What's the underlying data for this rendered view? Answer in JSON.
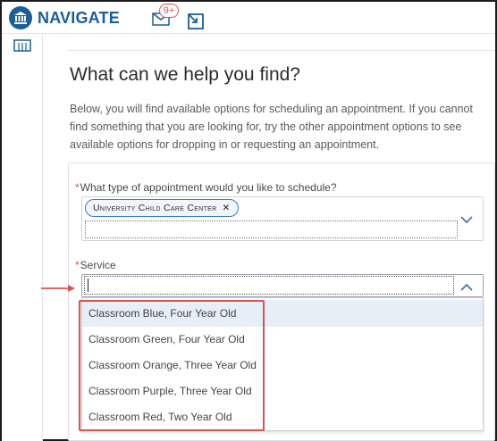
{
  "app": {
    "brand": "NAVIGATE",
    "notification_count": "9+"
  },
  "page": {
    "title": "What can we help you find?",
    "intro": "Below, you will find available options for scheduling an appointment. If you cannot find something that you are looking for, try the other appointment options to see available options for dropping in or requesting an appointment."
  },
  "form": {
    "appointment_type": {
      "required_mark": "*",
      "label": "What type of appointment would you like to schedule?",
      "selected": "University Child Care Center",
      "remove_glyph": "✕"
    },
    "service": {
      "required_mark": "*",
      "label": "Service",
      "value": "",
      "options": [
        "Classroom Blue, Four Year Old",
        "Classroom Green, Four Year Old",
        "Classroom Orange, Three Year Old",
        "Classroom Purple, Three Year Old",
        "Classroom Red, Two Year Old"
      ]
    }
  },
  "icons": {
    "logo": "institution-icon",
    "mail": "mail-icon",
    "launch": "open-external-icon",
    "rail": "calendar-icon",
    "collapse": "chevron-down-icon",
    "expand": "chevron-up-icon"
  },
  "colors": {
    "brand": "#1a5e9a",
    "required": "#d9534f",
    "annotation": "#d9534f",
    "pill_border": "#3a7bd5",
    "option_active": "#e6eef8"
  }
}
